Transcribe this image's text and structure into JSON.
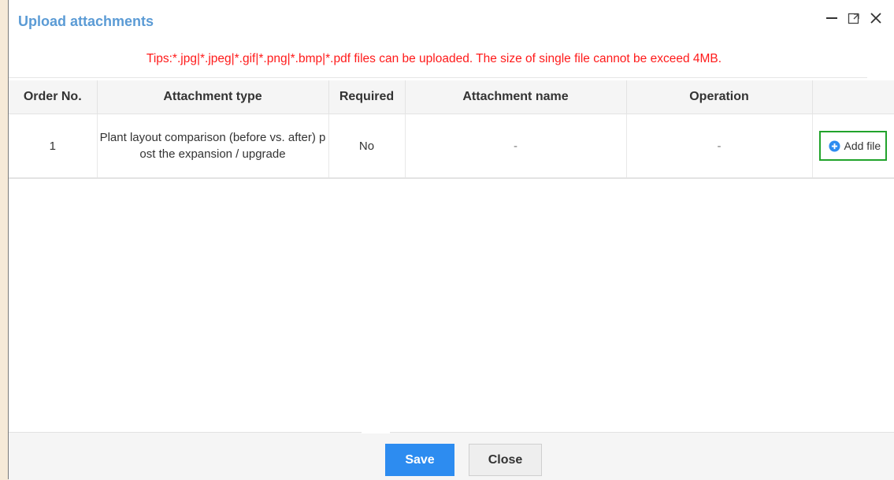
{
  "dialog": {
    "title": "Upload attachments",
    "controls": [
      {
        "name": "minimize-icon",
        "glyph": "—"
      },
      {
        "name": "maximize-icon",
        "glyph": "□"
      },
      {
        "name": "close-icon",
        "glyph": "✕"
      }
    ]
  },
  "tips": "Tips:*.jpg|*.jpeg|*.gif|*.png|*.bmp|*.pdf files can be uploaded. The size of single file cannot be exceed 4MB.",
  "table": {
    "headers": [
      "Order No.",
      "Attachment type",
      "Required",
      "Attachment name",
      "Operation",
      ""
    ],
    "rows": [
      {
        "order": "1",
        "type": "Plant layout comparison (before vs. after) post the expansion / upgrade",
        "required": "No",
        "name": "-",
        "operation": "-",
        "action_label": "Add file",
        "action_icon": "plus-circle-icon"
      }
    ]
  },
  "footer": {
    "save_label": "Save",
    "close_label": "Close"
  },
  "colors": {
    "title": "#5b9bd5",
    "tips": "#ff1a1a",
    "save_button": "#2d8cf0",
    "add_file_highlight": "#21a32b",
    "add_file_icon": "#2d8cf0"
  }
}
